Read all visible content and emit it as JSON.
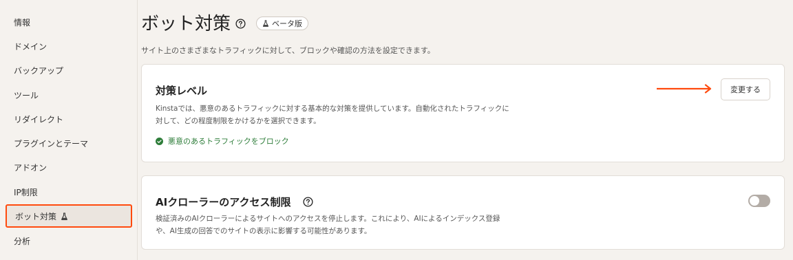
{
  "sidebar": {
    "items": [
      {
        "label": "情報"
      },
      {
        "label": "ドメイン"
      },
      {
        "label": "バックアップ"
      },
      {
        "label": "ツール"
      },
      {
        "label": "リダイレクト"
      },
      {
        "label": "プラグインとテーマ"
      },
      {
        "label": "アドオン"
      },
      {
        "label": "IP制限"
      },
      {
        "label": "ボット対策",
        "active": true
      },
      {
        "label": "分析"
      }
    ]
  },
  "header": {
    "title": "ボット対策",
    "badge": "ベータ版",
    "subtitle": "サイト上のさまざまなトラフィックに対して、ブロックや確認の方法を設定できます。"
  },
  "protection_card": {
    "title": "対策レベル",
    "description": "Kinstaでは、悪意のあるトラフィックに対する基本的な対策を提供しています。自動化されたトラフィックに対して、どの程度制限をかけるかを選択できます。",
    "status": "悪意のあるトラフィックをブロック",
    "button": "変更する"
  },
  "ai_card": {
    "title": "AIクローラーのアクセス制限",
    "description": "検証済みのAIクローラーによるサイトへのアクセスを停止します。これにより、AIによるインデックス登録や、AI生成の回答でのサイトの表示に影響する可能性があります。",
    "toggle_on": false
  },
  "colors": {
    "highlight": "#ff4a0d",
    "status_green": "#2e7d3a",
    "background": "#f5f2ee"
  }
}
